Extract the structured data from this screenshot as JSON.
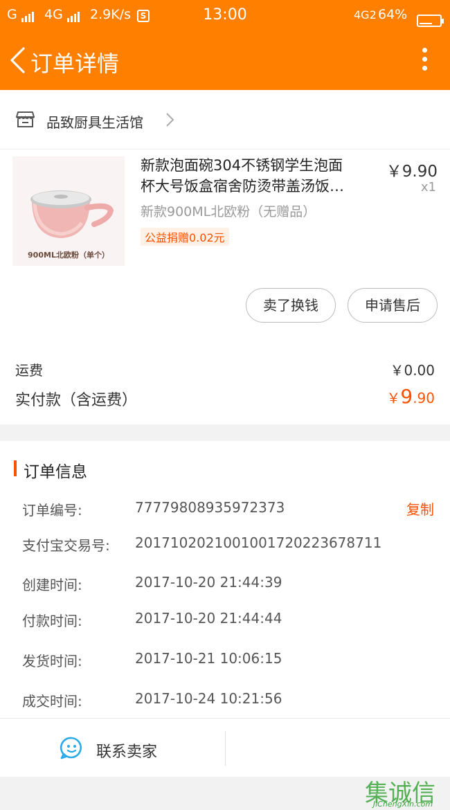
{
  "status_bar": {
    "carrier1": "G",
    "carrier2": "4G",
    "speed": "2.9K/s",
    "s_badge": "S",
    "time": "13:00",
    "network": "4G2",
    "battery": "64%",
    "battery_level": 0.64
  },
  "nav": {
    "title": "订单详情",
    "back_icon": "chevron-left-icon",
    "more_icon": "more-vertical-icon"
  },
  "shop": {
    "name": "品致厨具生活馆",
    "icon": "store-icon"
  },
  "product": {
    "title_line1": "新款泡面碗304不锈钢学生泡面",
    "title_line2": "杯大号饭盒宿舍防烫带盖汤饭…",
    "price": "￥9.90",
    "qty": "x1",
    "spec": "新款900ML北欧粉（无赠品）",
    "charity": "公益捐赠0.02元",
    "thumb_label": "900ML北欧粉（单个）"
  },
  "buttons": {
    "resell": "卖了换钱",
    "aftersale": "申请售后"
  },
  "fees": {
    "shipping_label": "运费",
    "shipping_value": "￥0.00",
    "paid_label": "实付款（含运费）",
    "paid_currency": "￥",
    "paid_int": "9",
    "paid_dec": ".90"
  },
  "order_info": {
    "section_title": "订单信息",
    "copy_label": "复制",
    "rows": [
      {
        "key": "订单编号:",
        "value": "77779808935972373"
      },
      {
        "key": "支付宝交易号:",
        "value": "2017102021001001720223678711"
      },
      {
        "key": "创建时间:",
        "value": "2017-10-20 21:44:39"
      },
      {
        "key": "付款时间:",
        "value": "2017-10-20 21:44:44"
      },
      {
        "key": "发货时间:",
        "value": "2017-10-21 10:06:15"
      },
      {
        "key": "成交时间:",
        "value": "2017-10-24 10:21:56"
      }
    ]
  },
  "contact": {
    "label": "联系卖家",
    "icon": "chat-bubble-icon"
  },
  "watermark": {
    "chars": "集诚信",
    "url": "JiChengXin.com"
  },
  "colors": {
    "brand_orange": "#ff8000",
    "accent_red_orange": "#ff5000",
    "chat_blue": "#29a9e8"
  }
}
